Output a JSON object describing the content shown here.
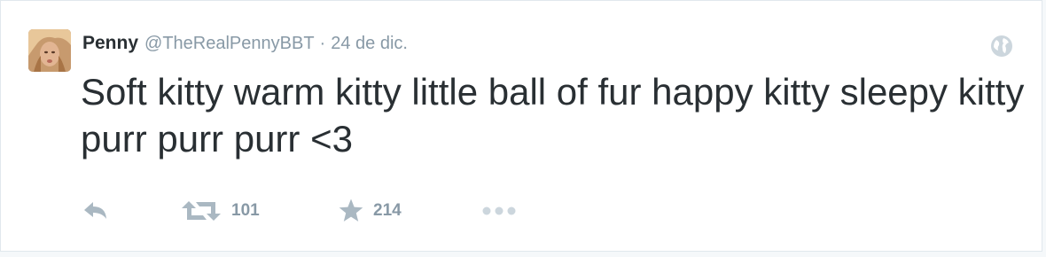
{
  "tweet": {
    "author": {
      "display_name": "Penny",
      "screen_name": "@TheRealPennyBBT"
    },
    "separator": "·",
    "timestamp": "24 de dic.",
    "text": "Soft kitty warm kitty little ball of fur happy kitty sleepy kitty purr purr purr <3",
    "icons": {
      "avatar": "profile-avatar",
      "globe": "globe-icon",
      "reply": "reply-icon",
      "retweet": "retweet-icon",
      "favorite": "star-icon",
      "more": "more-dots-icon"
    },
    "stats": {
      "retweets": "101",
      "favorites": "214"
    },
    "colors": {
      "text": "#292f33",
      "muted": "#8899a6",
      "icon": "#aab8c2",
      "border": "#e1e8ed"
    }
  }
}
